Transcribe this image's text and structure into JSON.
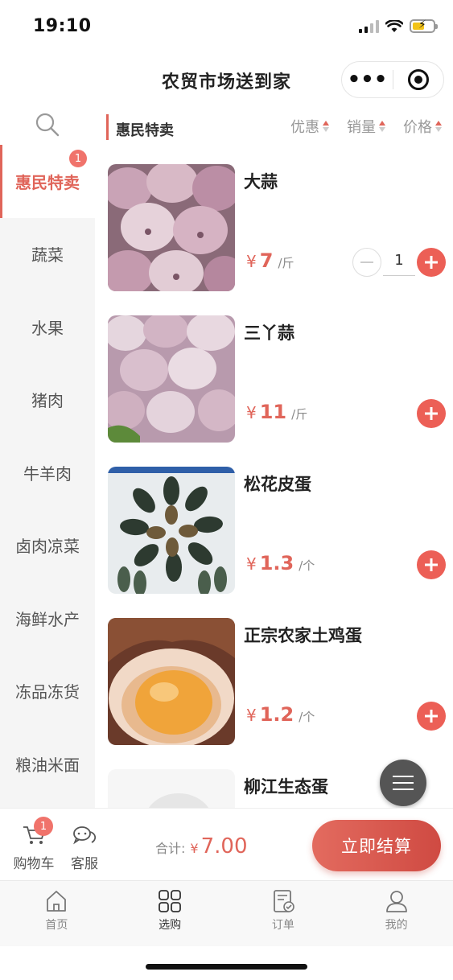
{
  "status_bar": {
    "time": "19:10"
  },
  "nav": {
    "title": "农贸市场送到家",
    "more_icon": "more-dots-icon",
    "close_icon": "target-close-icon"
  },
  "sidebar": {
    "search_icon": "search-icon",
    "items": [
      {
        "label": "惠民特卖",
        "active": true,
        "badge": "1"
      },
      {
        "label": "蔬菜"
      },
      {
        "label": "水果"
      },
      {
        "label": "猪肉"
      },
      {
        "label": "牛羊肉"
      },
      {
        "label": "卤肉凉菜"
      },
      {
        "label": "海鲜水产"
      },
      {
        "label": "冻品冻货"
      },
      {
        "label": "粮油米面"
      }
    ]
  },
  "content": {
    "category_title": "惠民特卖",
    "sorts": [
      {
        "label": "优惠"
      },
      {
        "label": "销量"
      },
      {
        "label": "价格"
      }
    ],
    "products": [
      {
        "name": "大蒜",
        "currency": "¥",
        "price": "7",
        "unit": "/斤",
        "qty": "1",
        "image": "garlic-photo"
      },
      {
        "name": "三丫蒜",
        "currency": "¥",
        "price": "11",
        "unit": "/斤",
        "image": "garlic-photo"
      },
      {
        "name": "松花皮蛋",
        "currency": "¥",
        "price": "1.3",
        "unit": "/个",
        "image": "preserved-egg-photo"
      },
      {
        "name": "正宗农家土鸡蛋",
        "currency": "¥",
        "price": "1.2",
        "unit": "/个",
        "image": "egg-yolk-photo"
      },
      {
        "name": "柳江生态蛋",
        "image": "egg-photo"
      }
    ]
  },
  "cart_bar": {
    "cart_label": "购物车",
    "cart_badge": "1",
    "service_label": "客服",
    "total_label": "合计:",
    "total_currency": "¥",
    "total_amount": "7.00",
    "checkout_label": "立即结算"
  },
  "tab_bar": {
    "tabs": [
      {
        "label": "首页",
        "icon": "home-icon"
      },
      {
        "label": "选购",
        "icon": "grid-icon",
        "active": true
      },
      {
        "label": "订单",
        "icon": "order-icon"
      },
      {
        "label": "我的",
        "icon": "user-icon"
      }
    ]
  },
  "colors": {
    "accent": "#e0655a",
    "checkout": "#d9534a",
    "badge": "#f0736b"
  }
}
